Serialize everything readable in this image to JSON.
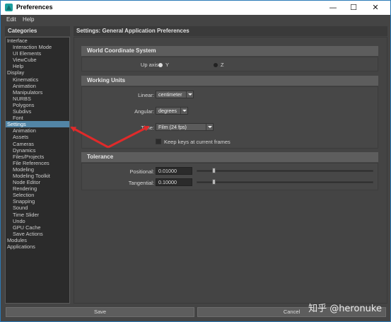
{
  "window": {
    "title": "Preferences"
  },
  "title_controls": {
    "minimize": "—",
    "maximize": "☐",
    "close": "✕"
  },
  "menu": [
    "Edit",
    "Help"
  ],
  "categories": {
    "header": "Categories",
    "items": [
      {
        "label": "Interface",
        "sub": false
      },
      {
        "label": "Interaction Mode",
        "sub": true
      },
      {
        "label": "UI Elements",
        "sub": true
      },
      {
        "label": "ViewCube",
        "sub": true
      },
      {
        "label": "Help",
        "sub": true
      },
      {
        "label": "Display",
        "sub": false
      },
      {
        "label": "Kinematics",
        "sub": true
      },
      {
        "label": "Animation",
        "sub": true
      },
      {
        "label": "Manipulators",
        "sub": true
      },
      {
        "label": "NURBS",
        "sub": true
      },
      {
        "label": "Polygons",
        "sub": true
      },
      {
        "label": "Subdivs",
        "sub": true
      },
      {
        "label": "Font",
        "sub": true
      },
      {
        "label": "Settings",
        "sub": false,
        "selected": true
      },
      {
        "label": "Animation",
        "sub": true
      },
      {
        "label": "Assets",
        "sub": true
      },
      {
        "label": "Cameras",
        "sub": true
      },
      {
        "label": "Dynamics",
        "sub": true
      },
      {
        "label": "Files/Projects",
        "sub": true
      },
      {
        "label": "File References",
        "sub": true
      },
      {
        "label": "Modeling",
        "sub": true
      },
      {
        "label": "Modeling Toolkit",
        "sub": true
      },
      {
        "label": "Node Editor",
        "sub": true
      },
      {
        "label": "Rendering",
        "sub": true
      },
      {
        "label": "Selection",
        "sub": true
      },
      {
        "label": "Snapping",
        "sub": true
      },
      {
        "label": "Sound",
        "sub": true
      },
      {
        "label": "Time Slider",
        "sub": true
      },
      {
        "label": "Undo",
        "sub": true
      },
      {
        "label": "GPU Cache",
        "sub": true
      },
      {
        "label": "Save Actions",
        "sub": true
      },
      {
        "label": "Modules",
        "sub": false
      },
      {
        "label": "Applications",
        "sub": false
      }
    ]
  },
  "settings": {
    "header": "Settings: General Application Preferences",
    "world": {
      "title": "World Coordinate System",
      "up_axis_label": "Up axis:",
      "y_label": "Y",
      "z_label": "Z",
      "selected": "Y"
    },
    "units": {
      "title": "Working Units",
      "linear_label": "Linear:",
      "linear_value": "centimeter",
      "angular_label": "Angular:",
      "angular_value": "degrees",
      "time_label": "Time:",
      "time_value": "Film (24 fps)",
      "keep_keys_label": "Keep keys at current frames",
      "keep_keys_checked": false
    },
    "tolerance": {
      "title": "Tolerance",
      "positional_label": "Positional:",
      "positional_value": "0.01000",
      "tangential_label": "Tangential:",
      "tangential_value": "0.10000"
    }
  },
  "buttons": {
    "save": "Save",
    "cancel": "Cancel"
  },
  "annotation_color": "#e02a2a",
  "watermark": "知乎 @heronuke"
}
